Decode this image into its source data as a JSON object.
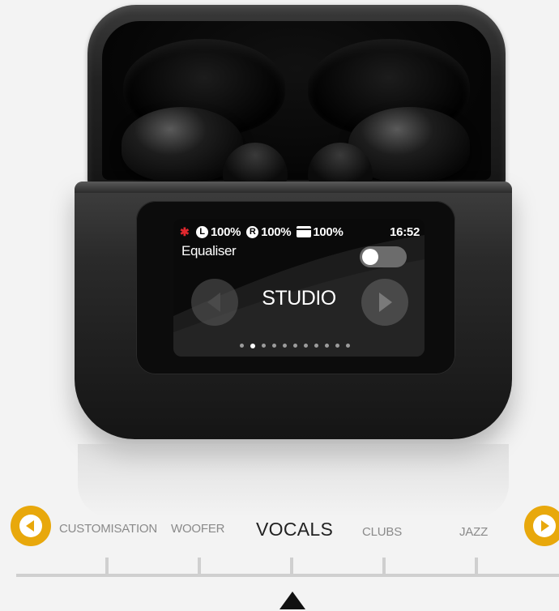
{
  "screen": {
    "status": {
      "bluetooth_icon": "bluetooth-icon",
      "left_label": "L",
      "left_battery": "100%",
      "right_label": "R",
      "right_battery": "100%",
      "case_battery": "100%",
      "time": "16:52"
    },
    "title": "Equaliser",
    "toggle_on": true,
    "preset": "STUDIO",
    "page_indicator": {
      "count": 11,
      "active_index": 1
    }
  },
  "selector": {
    "modes": [
      "CUSTOMISATION",
      "WOOFER",
      "VOCALS",
      "CLUBS",
      "JAZZ"
    ],
    "selected": "VOCALS",
    "prev_icon": "chevron-left-icon",
    "next_icon": "chevron-right-icon"
  },
  "colors": {
    "accent": "#e8a80c",
    "bluetooth": "#e0282e"
  }
}
